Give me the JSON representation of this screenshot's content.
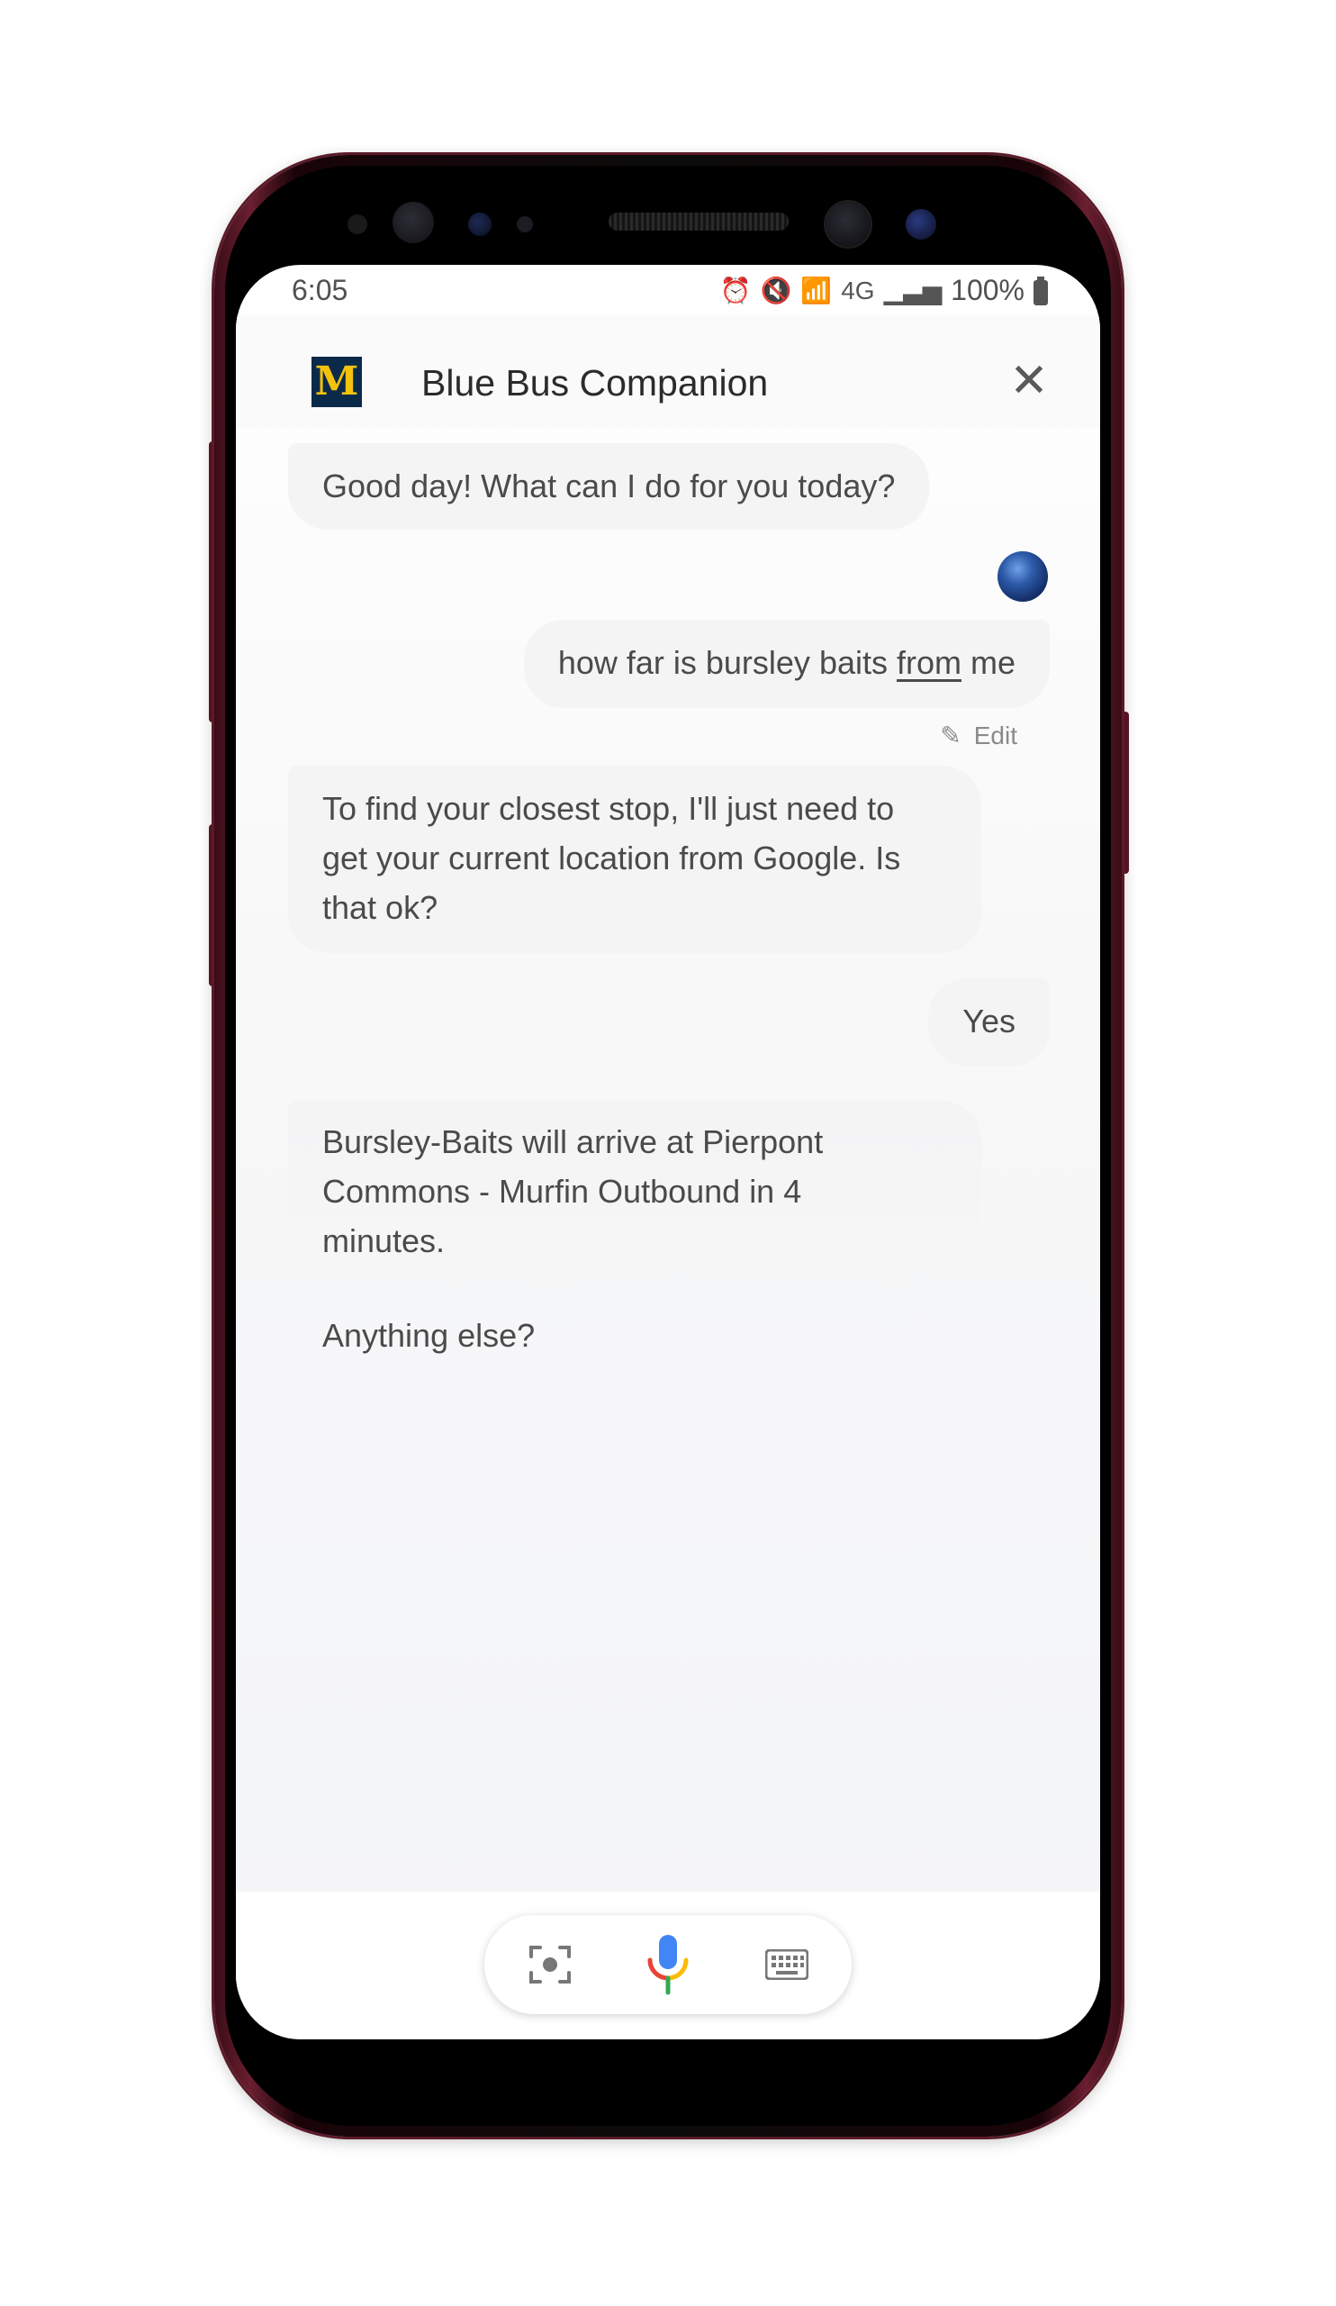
{
  "status": {
    "time": "6:05",
    "network": "4G",
    "battery": "100%"
  },
  "header": {
    "logo_letter": "M",
    "title": "Blue Bus Companion"
  },
  "conversation": {
    "bot_greeting": "Good day! What can I do for you today?",
    "user_query_part1": "how far is bursley baits ",
    "user_query_underlined": "from",
    "user_query_part2": " me",
    "edit_label": "Edit",
    "bot_location_request": "To find your closest stop, I'll just need to get your current location from Google. Is that ok?",
    "user_reply": "Yes",
    "bot_answer_line1": "Bursley-Baits will arrive at Pierpont",
    "bot_answer_line2": "Commons - Murfin Outbound in 4",
    "bot_answer_line3": "minutes.",
    "bot_followup": "Anything else?"
  },
  "input_bar": {
    "lens_icon": "lens-icon",
    "mic_icon": "microphone-icon",
    "keyboard_icon": "keyboard-icon"
  },
  "colors": {
    "phone_frame": "#5b1a28",
    "logo_bg": "#0b2a4a",
    "logo_fg": "#f4c20d",
    "bubble_bg": "#f4f4f5",
    "text": "#4a4a4a"
  }
}
